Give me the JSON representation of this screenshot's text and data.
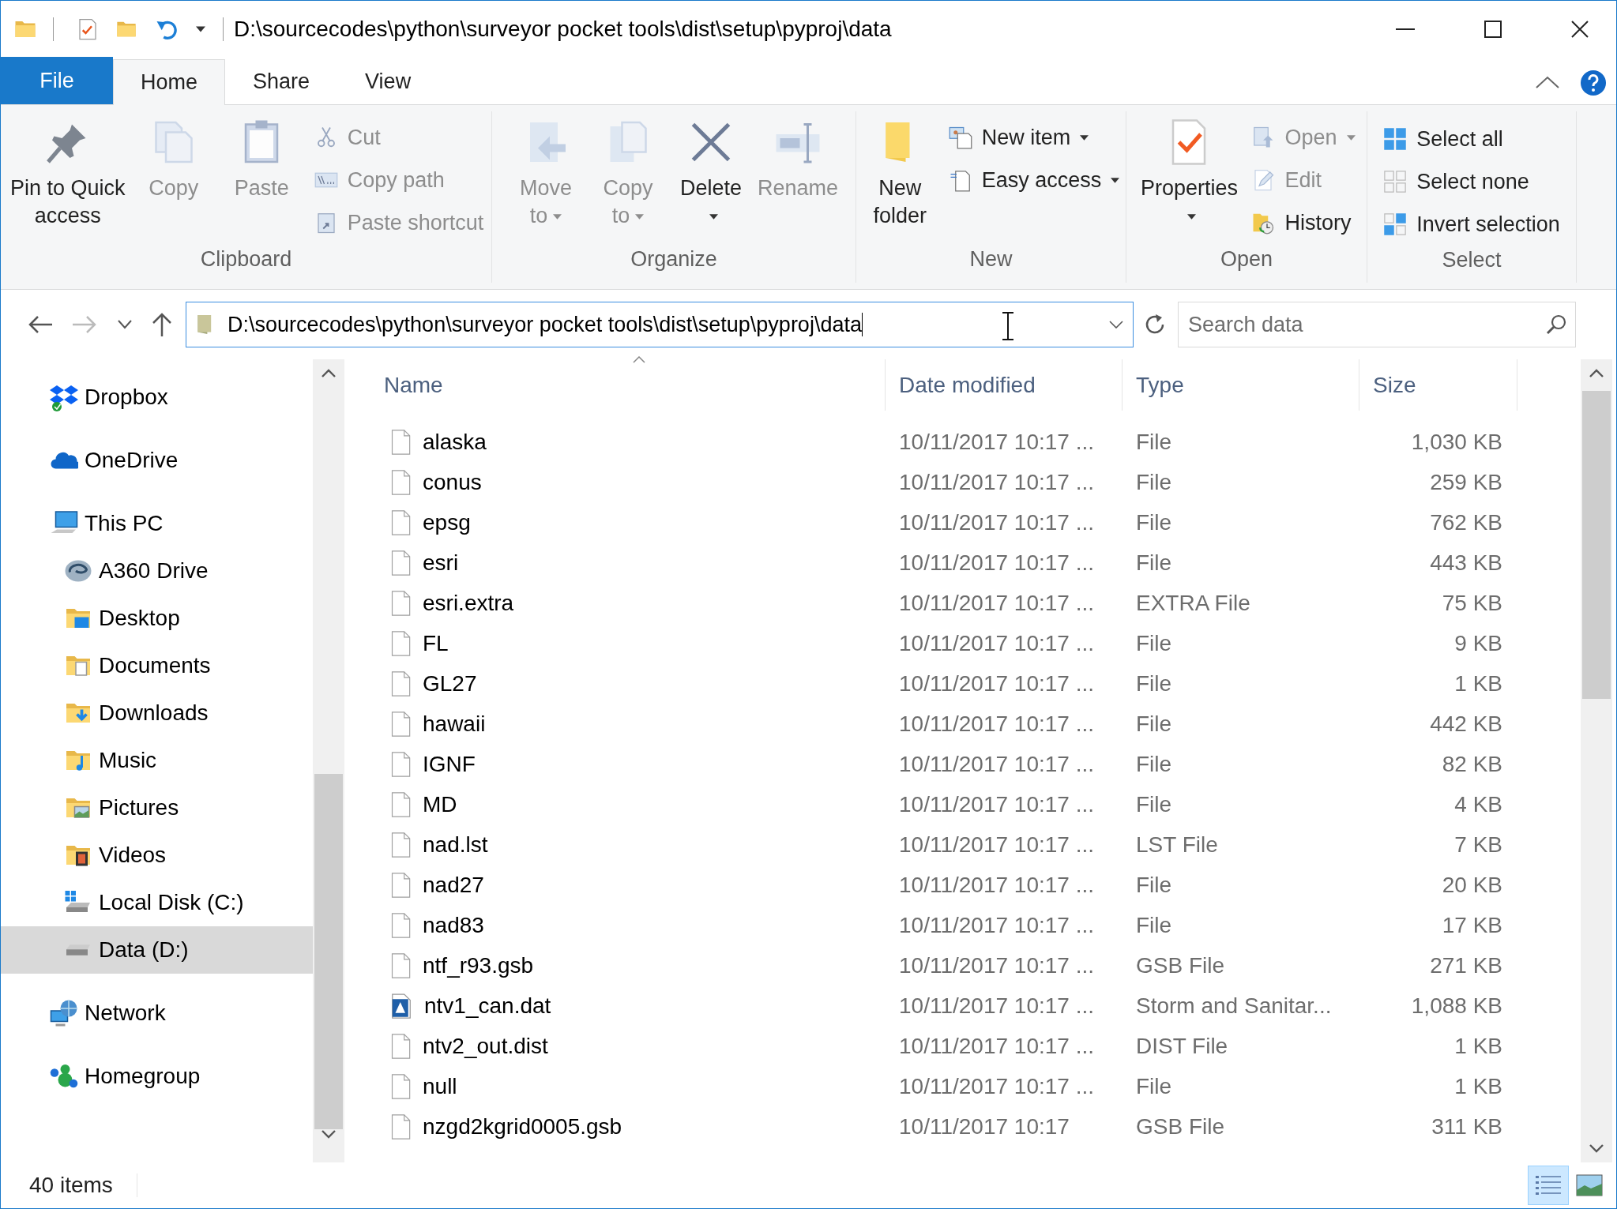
{
  "window": {
    "title": "D:\\sourcecodes\\python\\surveyor pocket tools\\dist\\setup\\pyproj\\data"
  },
  "ribbon_tabs": [
    {
      "label": "File",
      "kind": "file",
      "selected": false
    },
    {
      "label": "Home",
      "kind": "tab",
      "selected": true
    },
    {
      "label": "Share",
      "kind": "tab",
      "selected": false
    },
    {
      "label": "View",
      "kind": "tab",
      "selected": false
    }
  ],
  "ribbon_groups": [
    {
      "label": "Clipboard",
      "items": [
        {
          "label": "Pin to Quick access",
          "kind": "large",
          "disabled": false
        },
        {
          "label": "Copy",
          "kind": "large",
          "disabled": true
        },
        {
          "label": "Paste",
          "kind": "large",
          "disabled": true
        },
        {
          "label": "Cut",
          "kind": "small",
          "disabled": true
        },
        {
          "label": "Copy path",
          "kind": "small",
          "disabled": true
        },
        {
          "label": "Paste shortcut",
          "kind": "small",
          "disabled": true
        }
      ]
    },
    {
      "label": "Organize",
      "items": [
        {
          "label": "Move to",
          "kind": "large",
          "disabled": true,
          "dropdown": true
        },
        {
          "label": "Copy to",
          "kind": "large",
          "disabled": true,
          "dropdown": true
        },
        {
          "label": "Delete",
          "kind": "large",
          "disabled": false,
          "dropdown": true
        },
        {
          "label": "Rename",
          "kind": "large",
          "disabled": true
        }
      ]
    },
    {
      "label": "New",
      "items": [
        {
          "label": "New folder",
          "kind": "large",
          "disabled": false
        },
        {
          "label": "New item",
          "kind": "small",
          "disabled": false,
          "dropdown": true
        },
        {
          "label": "Easy access",
          "kind": "small",
          "disabled": false,
          "dropdown": true
        }
      ]
    },
    {
      "label": "Open",
      "items": [
        {
          "label": "Properties",
          "kind": "large",
          "disabled": false,
          "dropdown": true
        },
        {
          "label": "Open",
          "kind": "small",
          "disabled": true,
          "dropdown": true
        },
        {
          "label": "Edit",
          "kind": "small",
          "disabled": true
        },
        {
          "label": "History",
          "kind": "small",
          "disabled": false
        }
      ]
    },
    {
      "label": "Select",
      "items": [
        {
          "label": "Select all",
          "kind": "small",
          "disabled": false
        },
        {
          "label": "Select none",
          "kind": "small",
          "disabled": false
        },
        {
          "label": "Invert selection",
          "kind": "small",
          "disabled": false
        }
      ]
    }
  ],
  "address": {
    "value": "D:\\sourcecodes\\python\\surveyor pocket tools\\dist\\setup\\pyproj\\data"
  },
  "search": {
    "placeholder": "Search data"
  },
  "nav": [
    {
      "label": "Dropbox",
      "selected": false
    },
    {
      "label": "OneDrive",
      "selected": false
    },
    {
      "label": "This PC",
      "selected": false,
      "children": [
        {
          "label": "A360 Drive",
          "selected": false
        },
        {
          "label": "Desktop",
          "selected": false
        },
        {
          "label": "Documents",
          "selected": false
        },
        {
          "label": "Downloads",
          "selected": false
        },
        {
          "label": "Music",
          "selected": false
        },
        {
          "label": "Pictures",
          "selected": false
        },
        {
          "label": "Videos",
          "selected": false
        },
        {
          "label": "Local Disk (C:)",
          "selected": false
        },
        {
          "label": "Data (D:)",
          "selected": true
        }
      ]
    },
    {
      "label": "Network",
      "selected": false
    },
    {
      "label": "Homegroup",
      "selected": false
    }
  ],
  "table": {
    "columns": [
      "Name",
      "Date modified",
      "Type",
      "Size"
    ],
    "rows": [
      {
        "name": "alaska",
        "date": "10/11/2017 10:17 ...",
        "type": "File",
        "size": "1,030 KB",
        "kind": "file"
      },
      {
        "name": "conus",
        "date": "10/11/2017 10:17 ...",
        "type": "File",
        "size": "259 KB",
        "kind": "file"
      },
      {
        "name": "epsg",
        "date": "10/11/2017 10:17 ...",
        "type": "File",
        "size": "762 KB",
        "kind": "file"
      },
      {
        "name": "esri",
        "date": "10/11/2017 10:17 ...",
        "type": "File",
        "size": "443 KB",
        "kind": "file"
      },
      {
        "name": "esri.extra",
        "date": "10/11/2017 10:17 ...",
        "type": "EXTRA File",
        "size": "75 KB",
        "kind": "file"
      },
      {
        "name": "FL",
        "date": "10/11/2017 10:17 ...",
        "type": "File",
        "size": "9 KB",
        "kind": "file"
      },
      {
        "name": "GL27",
        "date": "10/11/2017 10:17 ...",
        "type": "File",
        "size": "1 KB",
        "kind": "file"
      },
      {
        "name": "hawaii",
        "date": "10/11/2017 10:17 ...",
        "type": "File",
        "size": "442 KB",
        "kind": "file"
      },
      {
        "name": "IGNF",
        "date": "10/11/2017 10:17 ...",
        "type": "File",
        "size": "82 KB",
        "kind": "file"
      },
      {
        "name": "MD",
        "date": "10/11/2017 10:17 ...",
        "type": "File",
        "size": "4 KB",
        "kind": "file"
      },
      {
        "name": "nad.lst",
        "date": "10/11/2017 10:17 ...",
        "type": "LST File",
        "size": "7 KB",
        "kind": "file"
      },
      {
        "name": "nad27",
        "date": "10/11/2017 10:17 ...",
        "type": "File",
        "size": "20 KB",
        "kind": "file"
      },
      {
        "name": "nad83",
        "date": "10/11/2017 10:17 ...",
        "type": "File",
        "size": "17 KB",
        "kind": "file"
      },
      {
        "name": "ntf_r93.gsb",
        "date": "10/11/2017 10:17 ...",
        "type": "GSB File",
        "size": "271 KB",
        "kind": "file"
      },
      {
        "name": "ntv1_can.dat",
        "date": "10/11/2017 10:17 ...",
        "type": "Storm and Sanitar...",
        "size": "1,088 KB",
        "kind": "dat"
      },
      {
        "name": "ntv2_out.dist",
        "date": "10/11/2017 10:17 ...",
        "type": "DIST File",
        "size": "1 KB",
        "kind": "file"
      },
      {
        "name": "null",
        "date": "10/11/2017 10:17 ...",
        "type": "File",
        "size": "1 KB",
        "kind": "file"
      },
      {
        "name": "nzgd2kgrid0005.gsb",
        "date": "10/11/2017 10:17",
        "type": "GSB File",
        "size": "311 KB",
        "kind": "file"
      }
    ]
  },
  "status_bar": {
    "text": "40 items",
    "views": [
      {
        "kind": "details",
        "selected": true
      },
      {
        "kind": "large-icons",
        "selected": false
      }
    ]
  }
}
